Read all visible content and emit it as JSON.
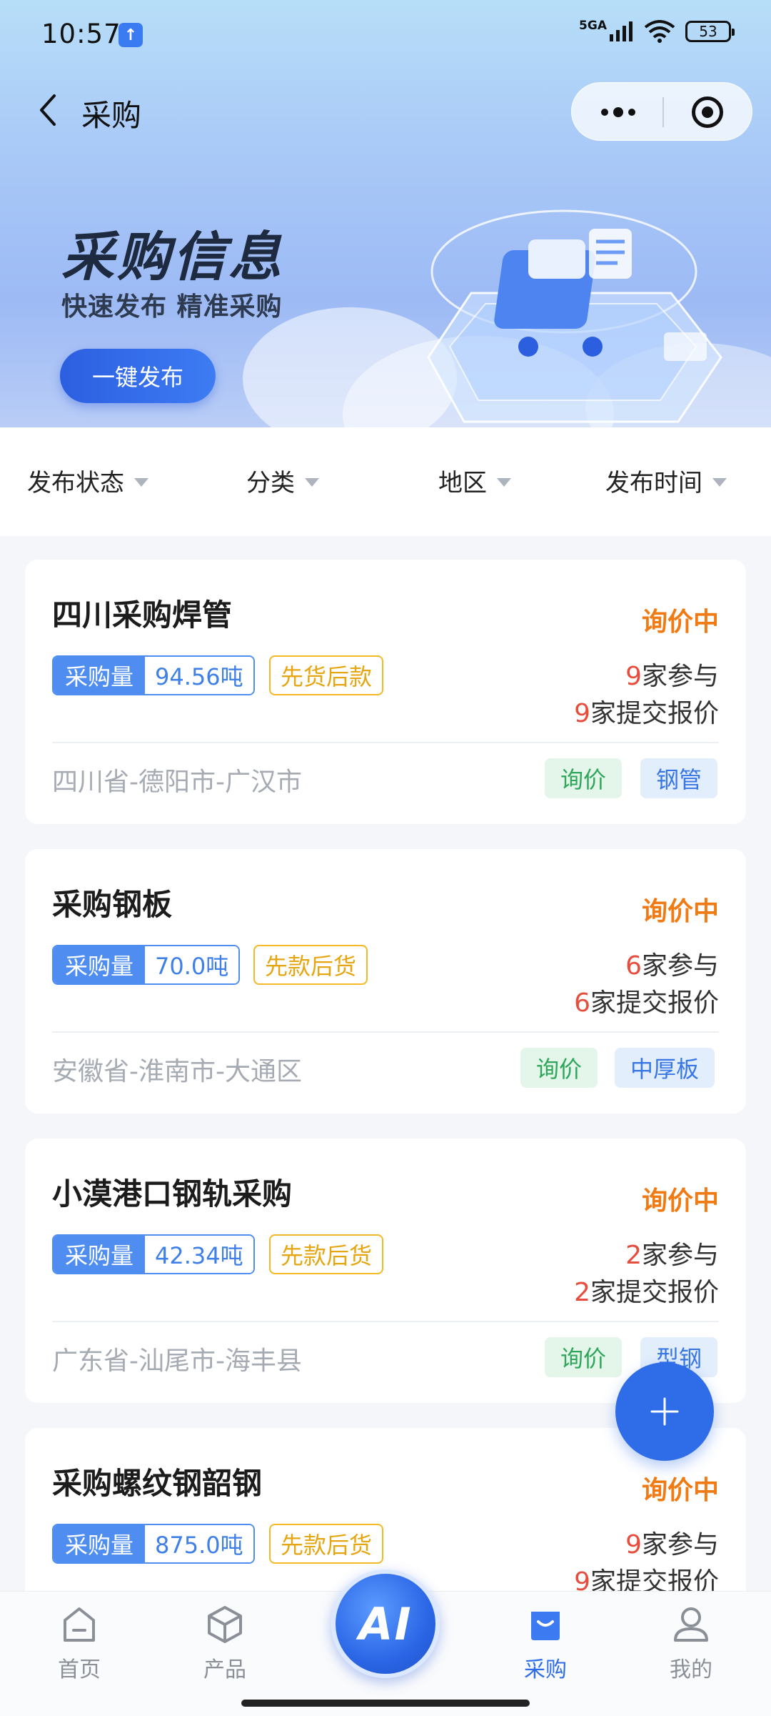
{
  "status_bar": {
    "time": "10:57",
    "network": "5GA",
    "battery": "53"
  },
  "nav": {
    "title": "采购"
  },
  "hero": {
    "title": "采购信息",
    "subtitle": "快速发布 精准采购",
    "button": "一键发布"
  },
  "filters": [
    "发布状态",
    "分类",
    "地区",
    "发布时间"
  ],
  "cards": [
    {
      "title": "四川采购焊管",
      "status": "询价中",
      "qty_label": "采购量",
      "qty": "94.56吨",
      "payment": "先货后款",
      "participants_n": "9",
      "participants_text": "家参与",
      "quotes_n": "9",
      "quotes_text": "家提交报价",
      "location": "四川省-德阳市-广汉市",
      "tag1": "询价",
      "tag2": "钢管"
    },
    {
      "title": "采购钢板",
      "status": "询价中",
      "qty_label": "采购量",
      "qty": "70.0吨",
      "payment": "先款后货",
      "participants_n": "6",
      "participants_text": "家参与",
      "quotes_n": "6",
      "quotes_text": "家提交报价",
      "location": "安徽省-淮南市-大通区",
      "tag1": "询价",
      "tag2": "中厚板"
    },
    {
      "title": "小漠港口钢轨采购",
      "status": "询价中",
      "qty_label": "采购量",
      "qty": "42.34吨",
      "payment": "先款后货",
      "participants_n": "2",
      "participants_text": "家参与",
      "quotes_n": "2",
      "quotes_text": "家提交报价",
      "location": "广东省-汕尾市-海丰县",
      "tag1": "询价",
      "tag2": "型钢"
    },
    {
      "title": "采购螺纹钢韶钢",
      "status": "询价中",
      "qty_label": "采购量",
      "qty": "875.0吨",
      "payment": "先款后货",
      "participants_n": "9",
      "participants_text": "家参与",
      "quotes_n": "9",
      "quotes_text": "家提交报价"
    }
  ],
  "fab": {
    "icon": "plus-icon"
  },
  "tabbar": {
    "items": [
      "首页",
      "产品",
      "采购",
      "我的"
    ],
    "ai_label": "AI",
    "active": "采购"
  },
  "colors": {
    "accent": "#2f6de8",
    "status": "#f07b15",
    "count": "#e74c3c"
  }
}
